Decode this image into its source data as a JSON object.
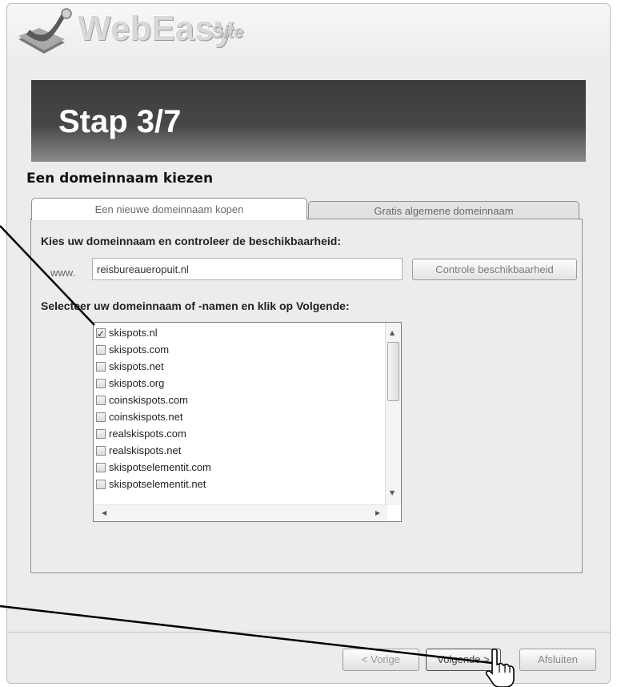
{
  "app": {
    "logo_name": "WebEasy",
    "logo_sub": "Site"
  },
  "banner": {
    "step_title": "Stap 3/7"
  },
  "section": {
    "title": "Een domeinnaam kiezen"
  },
  "tabs": [
    {
      "label": "Een nieuwe domeinnaam kopen",
      "active": true
    },
    {
      "label": "Gratis algemene domeinnaam",
      "active": false
    }
  ],
  "domain_check": {
    "instruction": "Kies uw domeinnaam en controleer de beschikbaarheid:",
    "prefix": "www.",
    "input_value": "reisbureaueropuit.nl",
    "check_button": "Controle beschikbaarheid"
  },
  "domain_list": {
    "instruction": "Selecteer uw domeinnaam of -namen en klik op Volgende:",
    "items": [
      {
        "name": "skispots.nl",
        "checked": true
      },
      {
        "name": "skispots.com",
        "checked": false
      },
      {
        "name": "skispots.net",
        "checked": false
      },
      {
        "name": "skispots.org",
        "checked": false
      },
      {
        "name": "coinskispots.com",
        "checked": false
      },
      {
        "name": "coinskispots.net",
        "checked": false
      },
      {
        "name": "realskispots.com",
        "checked": false
      },
      {
        "name": "realskispots.net",
        "checked": false
      },
      {
        "name": "skispotselementit.com",
        "checked": false
      },
      {
        "name": "skispotselementit.net",
        "checked": false
      }
    ]
  },
  "footer": {
    "prev_label": "< Vorige",
    "next_label": "Volgende >",
    "close_label": "Afsluiten"
  },
  "icons": {
    "logo": "webeasy-logo-icon",
    "cursor": "hand-pointer-icon"
  }
}
